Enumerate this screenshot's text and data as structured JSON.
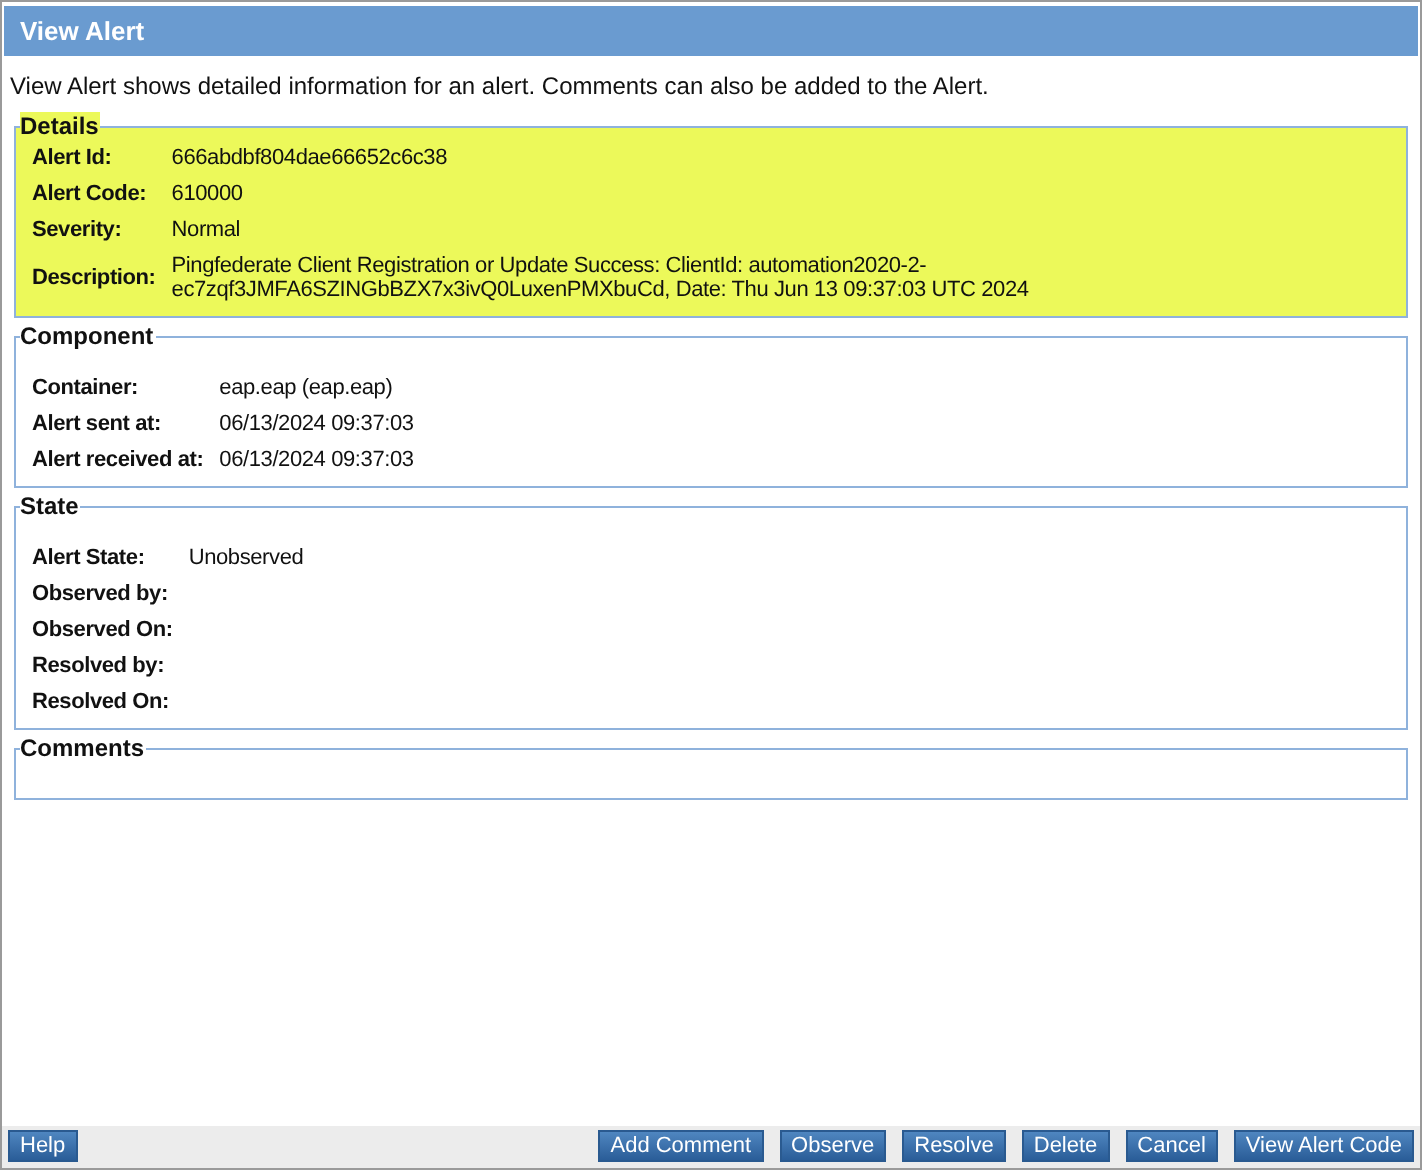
{
  "window": {
    "title": "View Alert"
  },
  "intro": "View Alert shows detailed information for an alert. Comments can also be added to the Alert.",
  "sections": [
    {
      "title": "Details",
      "highlighted": true,
      "rows": [
        {
          "label": "Alert Id:",
          "value": "666abdbf804dae66652c6c38"
        },
        {
          "label": "Alert Code:",
          "value": "610000"
        },
        {
          "label": "Severity:",
          "value": "Normal"
        },
        {
          "label": "Description:",
          "value": "Pingfederate Client Registration or Update Success: ClientId: automation2020-2-ec7zqf3JMFA6SZINGbBZX7x3ivQ0LuxenPMXbuCd, Date: Thu Jun 13 09:37:03 UTC 2024"
        }
      ]
    },
    {
      "title": "Component",
      "highlighted": false,
      "rows": [
        {
          "label": "Container:",
          "value": "eap.eap (eap.eap)"
        },
        {
          "label": "Alert sent at:",
          "value": "06/13/2024 09:37:03"
        },
        {
          "label": "Alert received at:",
          "value": "06/13/2024 09:37:03"
        }
      ]
    },
    {
      "title": "State",
      "highlighted": false,
      "rows": [
        {
          "label": "Alert State:",
          "value": "Unobserved"
        },
        {
          "label": "Observed by:"
        },
        {
          "label": "Observed On:"
        },
        {
          "label": "Resolved by:"
        },
        {
          "label": "Resolved On:"
        }
      ]
    },
    {
      "title": "Comments",
      "highlighted": false
    }
  ],
  "footer": {
    "left_buttons": [
      "Help"
    ],
    "right_buttons": [
      "Add Comment",
      "Observe",
      "Resolve",
      "Delete",
      "Cancel",
      "View Alert Code"
    ]
  }
}
